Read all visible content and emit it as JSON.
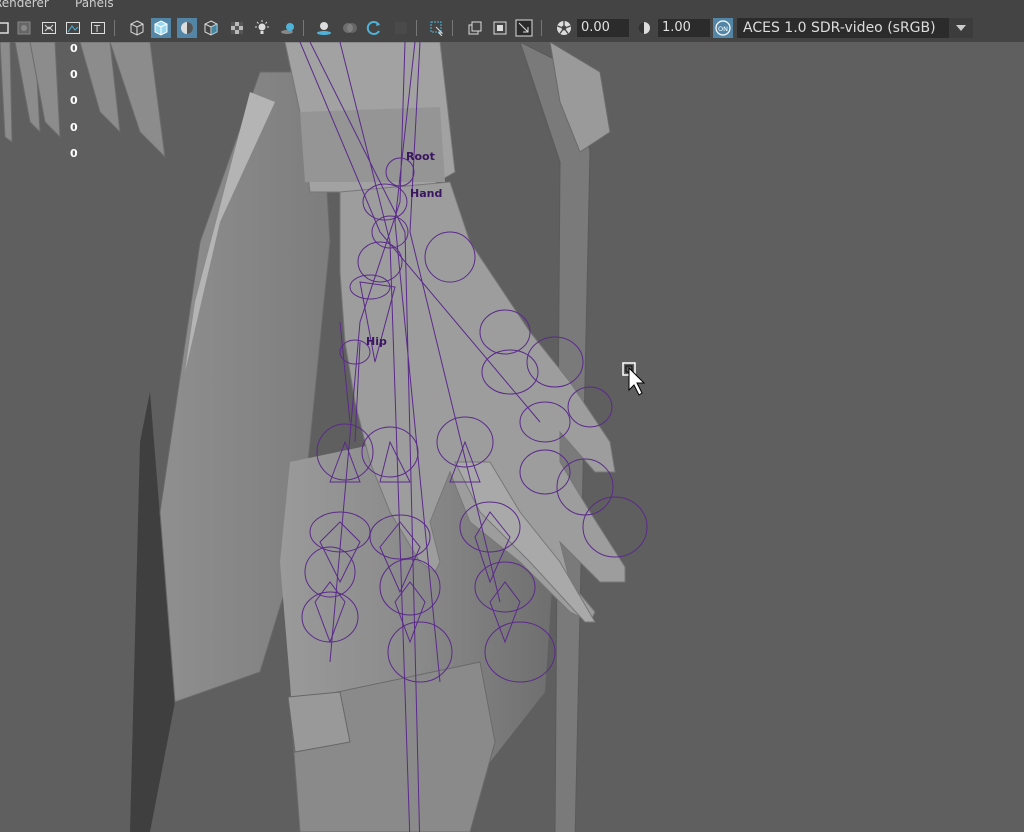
{
  "menubar": {
    "items": [
      "Renderer",
      "Panels"
    ]
  },
  "toolbar": {
    "exposure_value": "0.00",
    "gamma_value": "1.00",
    "color_mgmt_badge": "ON",
    "color_space": "ACES 1.0 SDR-video (sRGB)",
    "icons": [
      "select-camera",
      "camera-attributes",
      "bookmarks",
      "image-plane",
      "2d-pan-zoom",
      "grease-pencil",
      "wireframe",
      "smooth-shade-all",
      "wireframe-on-shaded",
      "default-material",
      "xray",
      "use-all-lights",
      "textured",
      "shadows",
      "screen-space-ambient-occlusion",
      "motion-blur",
      "anti-aliasing",
      "isolate-select",
      "xray-joints",
      "xray-active-components",
      "resolution-gate",
      "exposure",
      "gamma",
      "color-management",
      "color-space-dropdown"
    ],
    "accent_color": "#5285a6"
  },
  "viewport": {
    "hud_values": [
      "0",
      "0",
      "0",
      "0",
      "0"
    ],
    "joint_labels": {
      "root": "Root",
      "hand": "Hand",
      "hip": "Hip"
    },
    "joint_color": "#5a2a8a",
    "mesh_color": "#8e8e8e"
  }
}
